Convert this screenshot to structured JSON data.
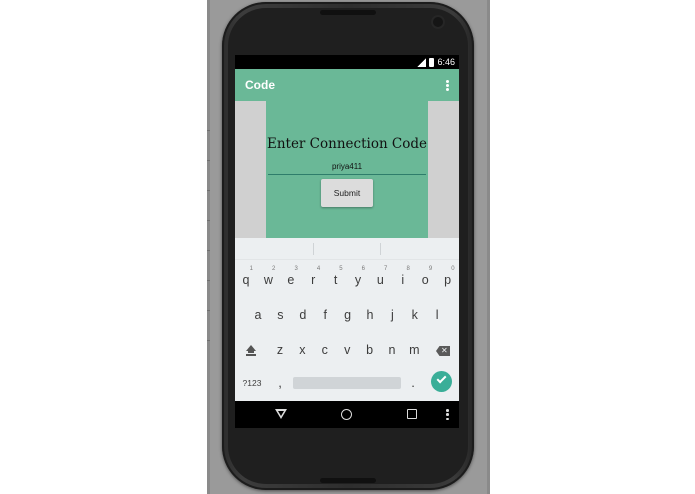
{
  "status_bar": {
    "time": "6:46",
    "icons": [
      "signal-icon",
      "battery-icon"
    ]
  },
  "app_bar": {
    "title": "Code",
    "menu_icon": "overflow-icon"
  },
  "form": {
    "heading": "Enter Connection Code",
    "code_value": "priya411",
    "submit_label": "Submit"
  },
  "keyboard": {
    "row1": [
      {
        "letter": "q",
        "num": "1"
      },
      {
        "letter": "w",
        "num": "2"
      },
      {
        "letter": "e",
        "num": "3"
      },
      {
        "letter": "r",
        "num": "4"
      },
      {
        "letter": "t",
        "num": "5"
      },
      {
        "letter": "y",
        "num": "6"
      },
      {
        "letter": "u",
        "num": "7"
      },
      {
        "letter": "i",
        "num": "8"
      },
      {
        "letter": "o",
        "num": "9"
      },
      {
        "letter": "p",
        "num": "0"
      }
    ],
    "row2": [
      "a",
      "s",
      "d",
      "f",
      "g",
      "h",
      "j",
      "k",
      "l"
    ],
    "row3": [
      "z",
      "x",
      "c",
      "v",
      "b",
      "n",
      "m"
    ],
    "symbols_label": "?123",
    "comma": ",",
    "period": "."
  },
  "nav_bar": {
    "icons": [
      "back-icon",
      "home-icon",
      "recent-apps-icon",
      "menu-icon"
    ]
  },
  "colors": {
    "app_primary": "#6ab897",
    "accent": "#3aae98",
    "keyboard_bg": "#eceff1"
  }
}
